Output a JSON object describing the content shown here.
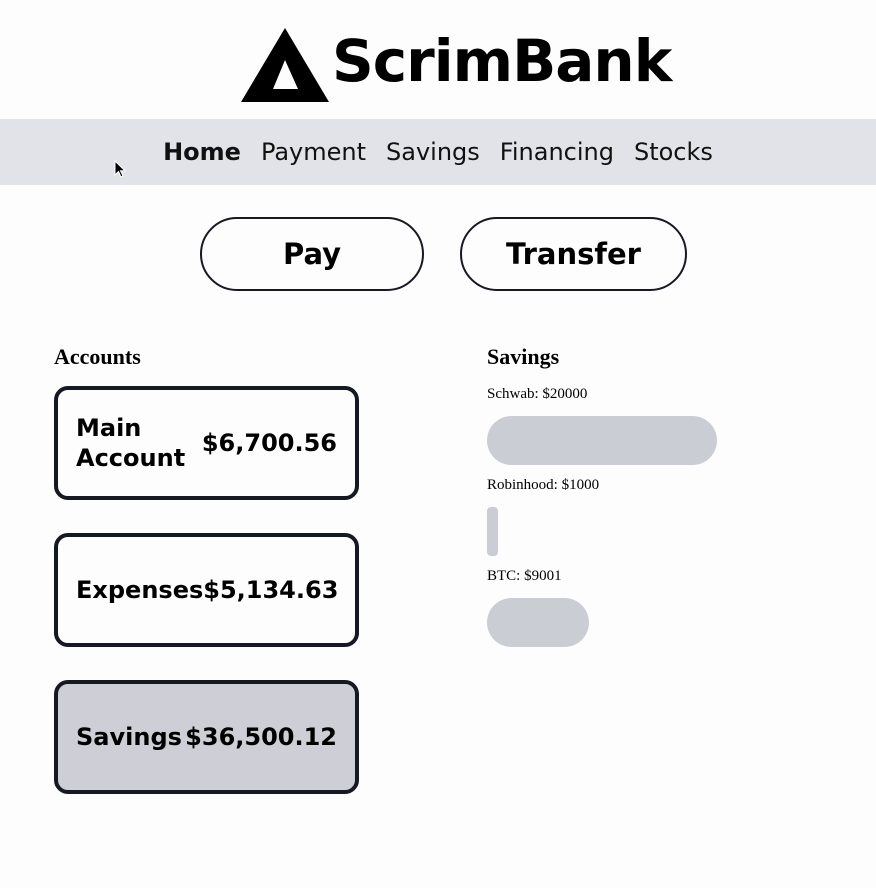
{
  "brand": {
    "name": "ScrimBank"
  },
  "nav": {
    "items": [
      {
        "label": "Home",
        "active": true
      },
      {
        "label": "Payment"
      },
      {
        "label": "Savings"
      },
      {
        "label": "Financing"
      },
      {
        "label": "Stocks"
      }
    ]
  },
  "actions": {
    "pay_label": "Pay",
    "transfer_label": "Transfer"
  },
  "accounts": {
    "heading": "Accounts",
    "items": [
      {
        "name": "Main Account",
        "amount": "$6,700.56"
      },
      {
        "name": "Expenses",
        "amount": "$5,134.63"
      },
      {
        "name": "Savings",
        "amount": "$36,500.12",
        "selected": true
      }
    ]
  },
  "savings": {
    "heading": "Savings",
    "items": [
      {
        "label": "Schwab: $20000",
        "value": 20000
      },
      {
        "label": "Robinhood: $1000",
        "value": 1000
      },
      {
        "label": "BTC: $9001",
        "value": 9001
      }
    ]
  },
  "colors": {
    "nav_bg": "#e2e3e8",
    "bar": "#cbcdd4",
    "selected_card": "#cdced6",
    "border": "#161922"
  }
}
